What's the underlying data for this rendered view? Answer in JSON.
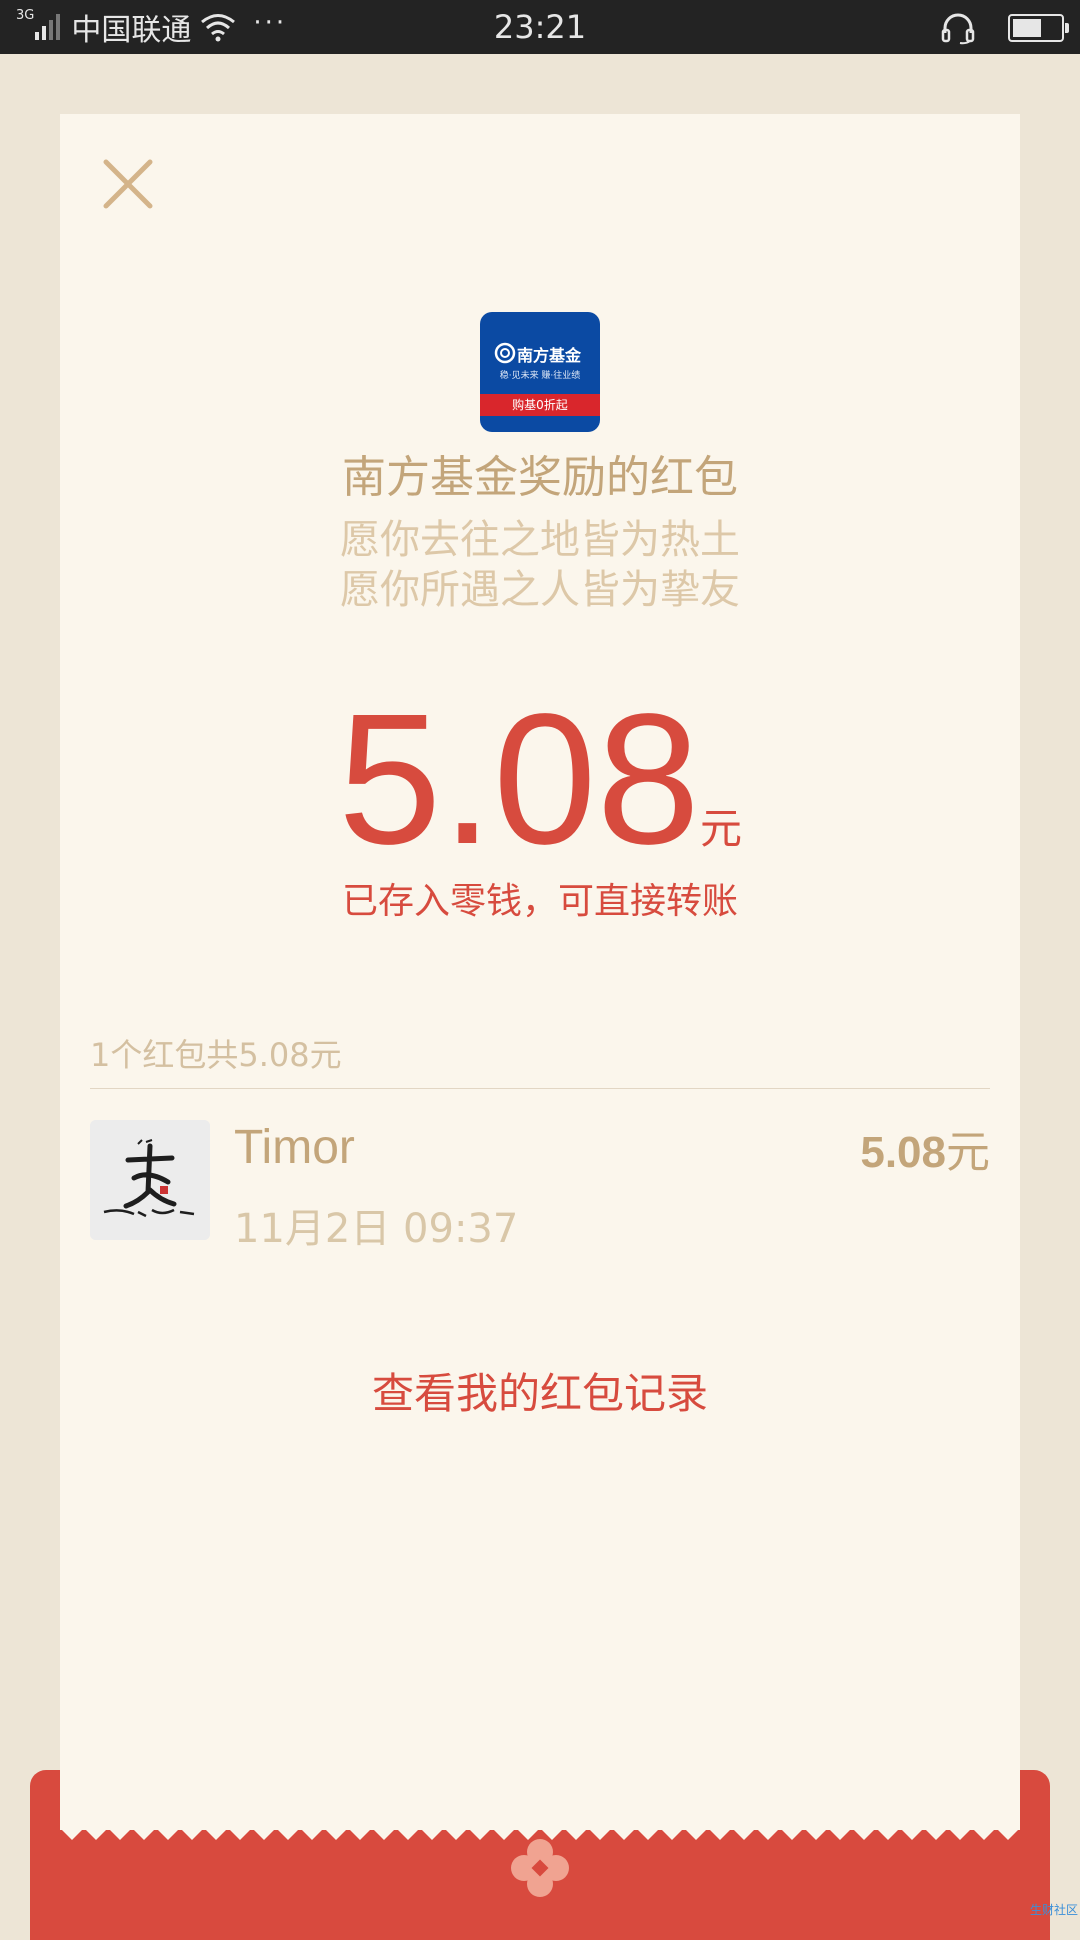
{
  "status_bar": {
    "network": "3G",
    "carrier": "中国联通",
    "more": "···",
    "time": "23:21"
  },
  "logo": {
    "name": "南方基金",
    "slogan": "稳·见未来  赚·往业绩",
    "ribbon": "购基0折起",
    "colors": {
      "background": "#0b4aa3",
      "ribbon": "#d9262c"
    }
  },
  "packet": {
    "title": "南方基金奖励的红包",
    "wish_line1": "愿你去往之地皆为热土",
    "wish_line2": "愿你所遇之人皆为挚友",
    "amount": "5.08",
    "amount_unit": "元",
    "note": "已存入零钱，可直接转账"
  },
  "summary": "1个红包共5.08元",
  "records": [
    {
      "name": "Timor",
      "time": "11月2日  09:37",
      "amount": "5.08",
      "unit": "元"
    }
  ],
  "history_link": "查看我的红包记录",
  "watermark": "生财社区",
  "colors": {
    "accent_red": "#d74b3e",
    "gold_text": "#c3a57a",
    "card_bg": "#fbf6ec",
    "page_bg": "#ede5d6"
  },
  "icons": {
    "close": "close-icon",
    "signal": "signal-icon",
    "wifi": "wifi-icon",
    "headset": "headset-icon",
    "battery": "battery-icon",
    "flower": "flower-icon"
  }
}
